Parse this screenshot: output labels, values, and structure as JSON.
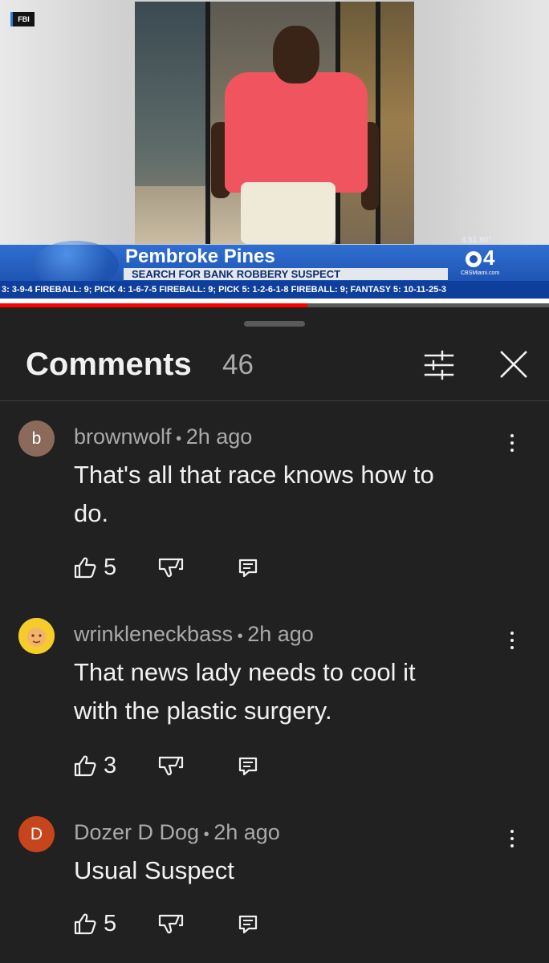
{
  "video": {
    "fbi_tag": "FBI",
    "location": "Pembroke Pines",
    "subtitle": "SEARCH FOR BANK ROBBERY SUSPECT",
    "time": "4:51 80°",
    "station": "4",
    "station_site": "CBSMiami.com",
    "ticker": "3: 3-9-4 FIREBALL: 9;  PICK 4: 1-6-7-5 FIREBALL: 9;  PICK 5: 1-2-6-1-8 FIREBALL: 9;  FANTASY 5: 10-11-25-3",
    "progress_fraction": 0.56
  },
  "comments_panel": {
    "title": "Comments",
    "count": "46"
  },
  "comments": [
    {
      "avatar_letter": "b",
      "avatar_color": "#8b6a5c",
      "author": "brownwolf",
      "time": "2h ago",
      "text_lines": [
        "That's all that race knows how to",
        "do."
      ],
      "likes": "5"
    },
    {
      "avatar_letter": "",
      "avatar_color": "#f4c21c",
      "author": "wrinkleneckbass",
      "time": "2h ago",
      "text_lines": [
        "That news lady needs to cool it",
        "with the plastic surgery."
      ],
      "likes": "3"
    },
    {
      "avatar_letter": "D",
      "avatar_color": "#c7451c",
      "author": "Dozer D Dog",
      "time": "2h ago",
      "text_lines": [
        "Usual Suspect"
      ],
      "likes": "5"
    }
  ],
  "colors": {
    "background": "#212121",
    "progress": "#ff0000",
    "broadcast_blue": "#1f55b4"
  }
}
